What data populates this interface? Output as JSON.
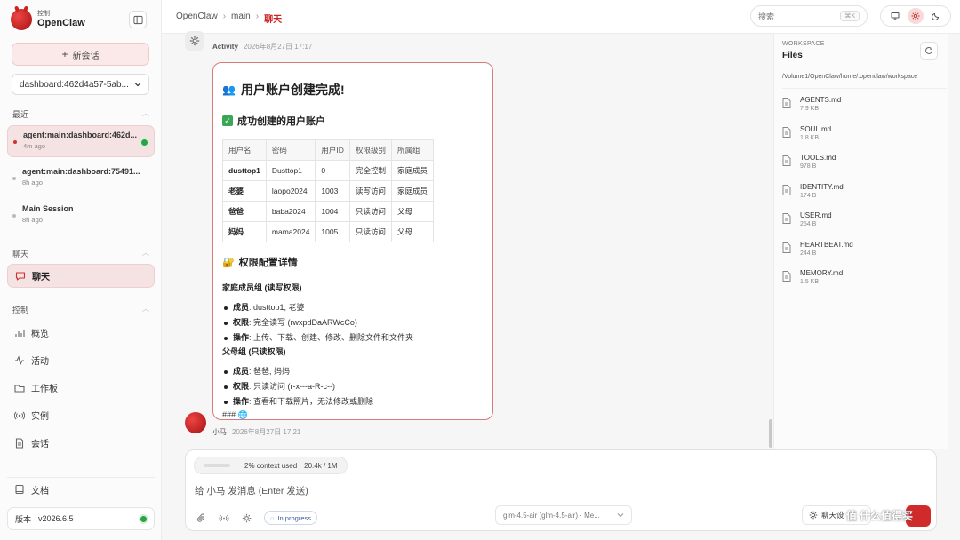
{
  "sidebar": {
    "brand_sub": "控制",
    "brand_name": "OpenClaw",
    "new_chat": "新会话",
    "session_select": "dashboard:462d4a57-5ab...",
    "recent_label": "最近",
    "sessions": [
      {
        "title": "agent:main:dashboard:462d...",
        "time": "4m ago"
      },
      {
        "title": "agent:main:dashboard:75491...",
        "time": "8h ago"
      },
      {
        "title": "Main Session",
        "time": "8h ago"
      }
    ],
    "chat_section": "聊天",
    "chat_item": "聊天",
    "control_section": "控制",
    "nav": [
      {
        "label": "概览",
        "icon": "bar-chart-icon"
      },
      {
        "label": "活动",
        "icon": "activity-icon"
      },
      {
        "label": "工作板",
        "icon": "folder-icon"
      },
      {
        "label": "实例",
        "icon": "radio-icon"
      },
      {
        "label": "会话",
        "icon": "document-icon"
      }
    ],
    "docs": "文档",
    "version_label": "版本",
    "version": "v2026.6.5"
  },
  "topbar": {
    "breadcrumb": [
      "OpenClaw",
      "main",
      "聊天"
    ],
    "search_placeholder": "搜索",
    "search_kbd": "⌘K",
    "theme_icons": [
      "monitor-icon",
      "sun-icon",
      "moon-icon"
    ]
  },
  "chat": {
    "activity_name": "Activity",
    "activity_time": "2026年8月27日 17:17",
    "heading": "用户账户创建完成!",
    "created_heading": "成功创建的用户账户",
    "table": {
      "headers": [
        "用户名",
        "密码",
        "用户ID",
        "权限级别",
        "所属组"
      ],
      "rows": [
        [
          "dusttop1",
          "Dusttop1",
          "0",
          "完全控制",
          "家庭成员"
        ],
        [
          "老婆",
          "laopo2024",
          "1003",
          "读写访问",
          "家庭成员"
        ],
        [
          "爸爸",
          "baba2024",
          "1004",
          "只读访问",
          "父母"
        ],
        [
          "妈妈",
          "mama2024",
          "1005",
          "只读访问",
          "父母"
        ]
      ]
    },
    "perm_heading": "权限配置详情",
    "group1": {
      "title": "家庭成员组 (读写权限)",
      "items": [
        {
          "k": "成员",
          "v": ": dusttop1, 老婆"
        },
        {
          "k": "权限",
          "v": ": 完全读写 (rwxpdDaARWcCo)"
        },
        {
          "k": "操作",
          "v": ": 上传、下载、创建、修改、删除文件和文件夹"
        }
      ]
    },
    "group2": {
      "title": "父母组 (只读权限)",
      "items": [
        {
          "k": "成员",
          "v": ": 爸爸, 妈妈"
        },
        {
          "k": "权限",
          "v": ": 只读访问 (r-x---a-R-c--)"
        },
        {
          "k": "操作",
          "v": ": 查看和下载照片，无法修改或删除"
        }
      ]
    },
    "trailing": "### 🌐",
    "assistant_name": "小马",
    "assistant_time": "2026年8月27日 17:21"
  },
  "composer": {
    "context_percent": 2,
    "context_text": "2% context used",
    "context_tokens": "20.4k / 1M",
    "placeholder": "给 小马 发消息 (Enter 发送)",
    "progress": "In progress",
    "model": "glm-4.5-air (glm-4.5-air) · Me...",
    "settings": "聊天设"
  },
  "files": {
    "section": "WORKSPACE",
    "title": "Files",
    "path": "/Volume1/OpenClaw/home/.openclaw/workspace",
    "items": [
      {
        "name": "AGENTS.md",
        "size": "7.9 KB"
      },
      {
        "name": "SOUL.md",
        "size": "1.8 KB"
      },
      {
        "name": "TOOLS.md",
        "size": "978 B"
      },
      {
        "name": "IDENTITY.md",
        "size": "174 B"
      },
      {
        "name": "USER.md",
        "size": "254 B"
      },
      {
        "name": "HEARTBEAT.md",
        "size": "244 B"
      },
      {
        "name": "MEMORY.md",
        "size": "1.5 KB"
      }
    ]
  },
  "watermark": "什么值得买",
  "accent": "#d12a2a"
}
